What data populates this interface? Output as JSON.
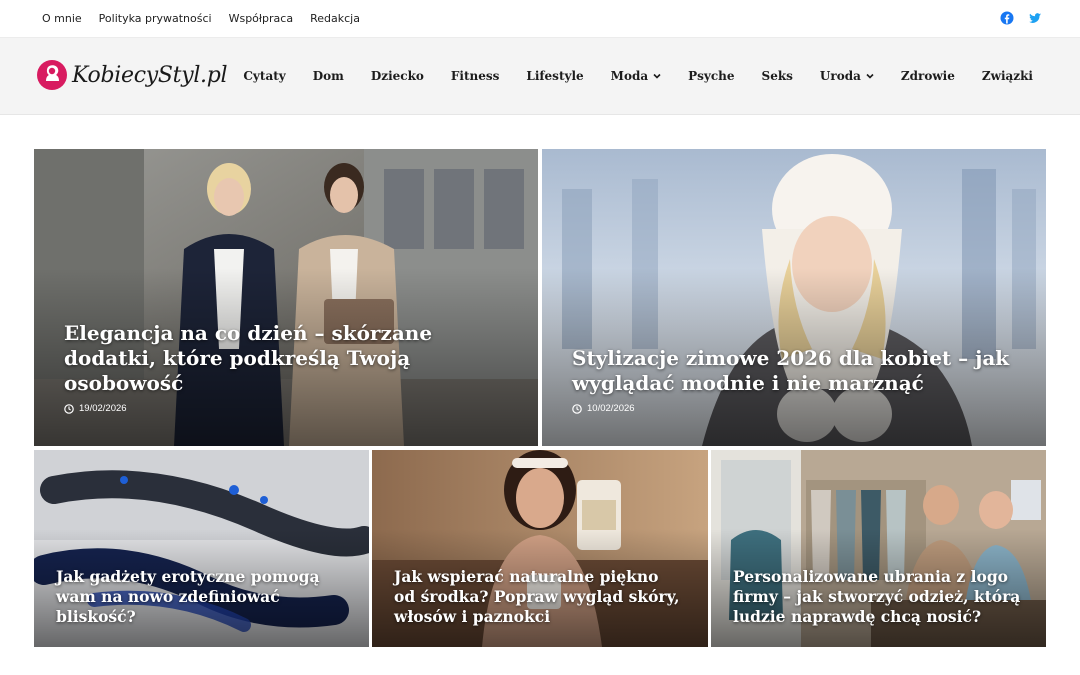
{
  "topnav": [
    "O mnie",
    "Polityka prywatności",
    "Współpraca",
    "Redakcja"
  ],
  "social": [
    "facebook-icon",
    "twitter-icon"
  ],
  "logo": {
    "text": "KobiecyStyl.pl"
  },
  "mainnav": [
    {
      "label": "Cytaty",
      "dropdown": false
    },
    {
      "label": "Dom",
      "dropdown": false
    },
    {
      "label": "Dziecko",
      "dropdown": false
    },
    {
      "label": "Fitness",
      "dropdown": false
    },
    {
      "label": "Lifestyle",
      "dropdown": false
    },
    {
      "label": "Moda",
      "dropdown": true
    },
    {
      "label": "Psyche",
      "dropdown": false
    },
    {
      "label": "Seks",
      "dropdown": false
    },
    {
      "label": "Uroda",
      "dropdown": true
    },
    {
      "label": "Zdrowie",
      "dropdown": false
    },
    {
      "label": "Związki",
      "dropdown": false
    }
  ],
  "featured": [
    {
      "title": "Elegancja na co dzień – skórzane dodatki, które podkreślą Twoją osobowość",
      "date": "19/02/2026"
    },
    {
      "title": "Stylizacje zimowe 2026 dla kobiet – jak wyglądać modnie i nie marznąć",
      "date": "10/02/2026"
    }
  ],
  "posts": [
    {
      "title": "Jak gadżety erotyczne pomogą wam na nowo zdefiniować bliskość?"
    },
    {
      "title": "Jak wspierać naturalne piękno od środka? Popraw wygląd skóry, włosów i paznokci"
    },
    {
      "title": "Personalizowane ubrania z logo firmy – jak stworzyć odzież, którą ludzie naprawdę chcą nosić?"
    }
  ],
  "colors": {
    "facebook": "#1877f2",
    "twitter": "#1da1f2",
    "logo_accent": "#d81b60"
  }
}
